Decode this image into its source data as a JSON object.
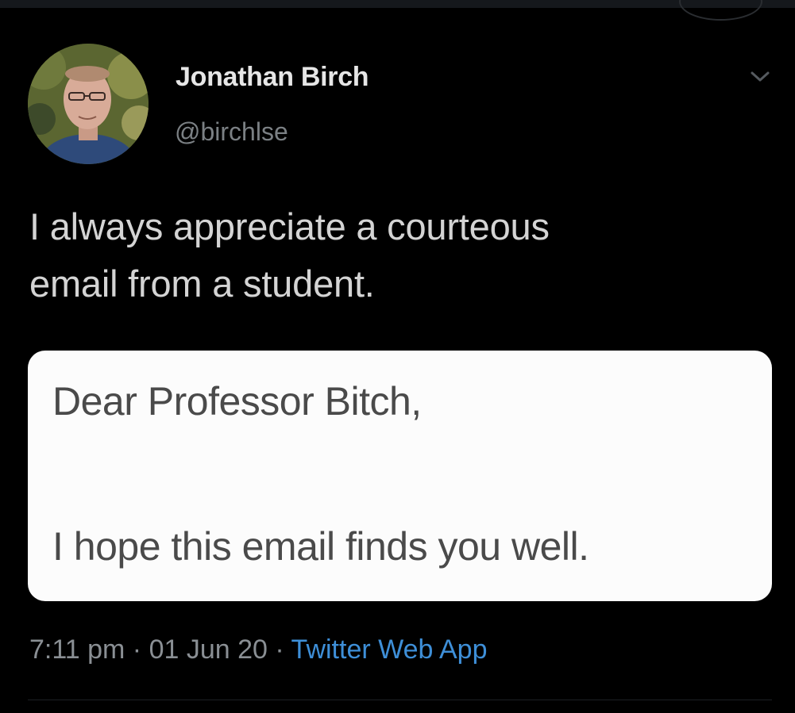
{
  "tweet": {
    "author_name": "Jonathan Birch",
    "author_handle": "@birchlse",
    "text_line1": "I always appreciate a courteous",
    "text_line2": "email from a student.",
    "embedded_email": {
      "greeting": "Dear Professor Bitch,",
      "body": "I hope this email finds you well."
    },
    "time": "7:11 pm",
    "date": "01 Jun 20",
    "separator": "·",
    "source_app": "Twitter Web App"
  },
  "icons": {
    "more_menu": "chevron-down-icon"
  },
  "colors": {
    "background": "#000000",
    "text": "#d4d4d4",
    "secondary_text": "#7b8084",
    "link": "#3e8fd8",
    "card": "#fcfcfc"
  }
}
